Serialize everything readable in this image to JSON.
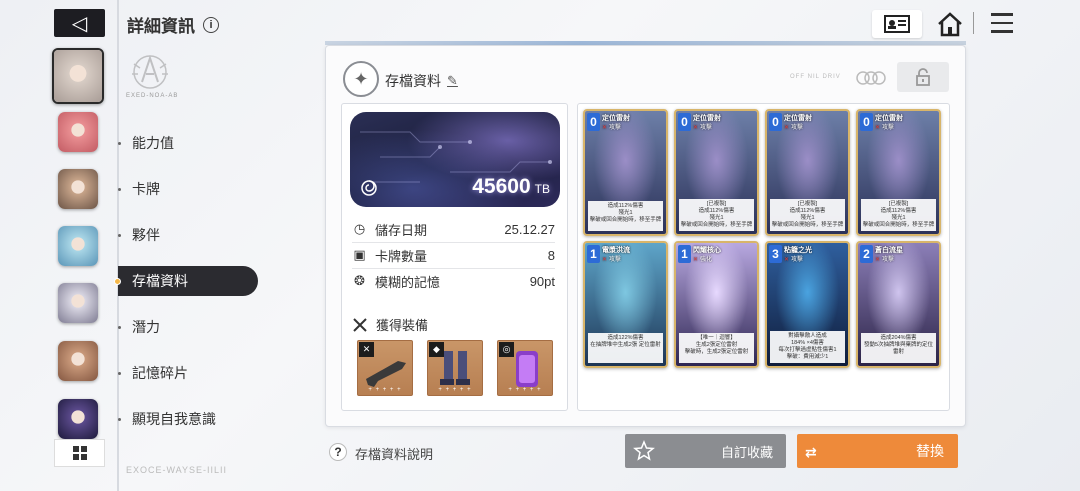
{
  "header": {
    "back_glyph": "◁",
    "title": "詳細資訊",
    "info_glyph": "i",
    "emblem_text": "EXED-NOA-AB"
  },
  "sidebar": {
    "portraits": [
      {
        "name": "portrait-1",
        "selected": true,
        "colors": [
          "#d7ccc4",
          "#a89c96"
        ]
      },
      {
        "name": "portrait-2",
        "colors": [
          "#e98f92",
          "#c25b63"
        ]
      },
      {
        "name": "portrait-3",
        "colors": [
          "#c7a489",
          "#6c5547"
        ]
      },
      {
        "name": "portrait-4",
        "colors": [
          "#a9d6e6",
          "#5a95b7"
        ]
      },
      {
        "name": "portrait-5",
        "colors": [
          "#d8d6e2",
          "#7f7c93"
        ]
      },
      {
        "name": "portrait-6",
        "colors": [
          "#c9997a",
          "#845741"
        ]
      },
      {
        "name": "portrait-7",
        "colors": [
          "#5b4a8c",
          "#1d1a3b"
        ]
      }
    ],
    "menu": [
      {
        "label": "能力值",
        "active": false
      },
      {
        "label": "卡牌",
        "active": false
      },
      {
        "label": "夥伴",
        "active": false
      },
      {
        "label": "存檔資料",
        "active": true
      },
      {
        "label": "潛力",
        "active": false
      },
      {
        "label": "記憶碎片",
        "active": false
      },
      {
        "label": "顯現自我意識",
        "active": false
      }
    ],
    "footer_mark": "EXOCE-WAYSE-IILII"
  },
  "topbar": {
    "id_card_icon": "id-card-icon",
    "home_icon": "home-icon",
    "menu_icon": "hamburger-icon"
  },
  "save": {
    "title": "存檔資料",
    "edit_glyph": "✎",
    "faded_tag": "OFF NIL DRIV",
    "storage_value": "45600",
    "storage_unit": "TB",
    "stats": [
      {
        "icon": "clock-icon",
        "label": "儲存日期",
        "value": "25.12.27"
      },
      {
        "icon": "cards-icon",
        "label": "卡牌數量",
        "value": "8"
      },
      {
        "icon": "brain-icon",
        "label": "模糊的記憶",
        "value": "90pt"
      }
    ],
    "equip_title": "獲得裝備",
    "equipment": [
      {
        "name": "equip-weapon",
        "badge": "✕",
        "stars": "+ + + + +",
        "art_color": "#3a3a3a"
      },
      {
        "name": "equip-armor",
        "badge": "◆",
        "stars": "+ + + + +",
        "art_color": "#4a4e7a"
      },
      {
        "name": "equip-accessory",
        "badge": "◎",
        "stars": "+ + + + +",
        "art_color": "#8a3ec9"
      }
    ]
  },
  "cards": [
    {
      "cost": "0",
      "name": "定位雷射",
      "type": "攻擊",
      "desc": "造成112%傷害\n殘光1\n擊破或回合開始時，移至手牌",
      "art": [
        "#6d7fa8",
        "#2b3158",
        "#9b8ec7"
      ]
    },
    {
      "cost": "0",
      "name": "定位雷射",
      "type": "攻擊",
      "desc": "[已複製]\n造成112%傷害\n殘光1\n擊破或回合開始時，移至手牌",
      "art": [
        "#6d7fa8",
        "#2b3158",
        "#9b8ec7"
      ]
    },
    {
      "cost": "0",
      "name": "定位雷射",
      "type": "攻擊",
      "desc": "[已複製]\n造成112%傷害\n殘光1\n擊破或回合開始時，移至手牌",
      "art": [
        "#6d7fa8",
        "#2b3158",
        "#9b8ec7"
      ]
    },
    {
      "cost": "0",
      "name": "定位雷射",
      "type": "攻擊",
      "desc": "[已複製]\n造成112%傷害\n殘光1\n擊破或回合開始時，移至手牌",
      "art": [
        "#6d7fa8",
        "#2b3158",
        "#9b8ec7"
      ]
    },
    {
      "cost": "1",
      "name": "電漿洪流",
      "type": "攻擊",
      "desc": "造成122%傷害\n在抽牌堆中生成2張 定位雷射",
      "art": [
        "#5ea5c9",
        "#1d3555",
        "#7ec7e1"
      ]
    },
    {
      "cost": "1",
      "name": "閃耀核心",
      "type": "強化",
      "desc": "【唯一｜迴響】\n生成2張定位雷射\n擊破時，生成2張定位雷射",
      "art": [
        "#b8a8e0",
        "#2e2652",
        "#e7d9ff"
      ]
    },
    {
      "cost": "3",
      "name": "粘籠之光",
      "type": "攻擊",
      "desc": "對攝擊敵人造成\n184% ×4傷害\n每次打擊過虛點性傷害1\n擊破：費用減少1",
      "art": [
        "#2f5f9e",
        "#0f1c3a",
        "#4aa3e0"
      ]
    },
    {
      "cost": "2",
      "name": "蒼白流星",
      "type": "攻擊",
      "desc": "造成204%傷害\n發動5次抽牌堆與棄牌的定位雷射",
      "art": [
        "#8c7fb8",
        "#2b2346",
        "#cfc4ee"
      ]
    }
  ],
  "bottom": {
    "help_glyph": "?",
    "help_text": "存檔資料說明",
    "custom_label": "自訂收藏",
    "replace_label": "替換",
    "replace_glyph": "⇄"
  },
  "colors": {
    "accent_orange": "#ee8a3a",
    "active_menu": "#2b2b30",
    "card_border": "#d8b56a",
    "cost_blue": "#2d6bd6"
  }
}
